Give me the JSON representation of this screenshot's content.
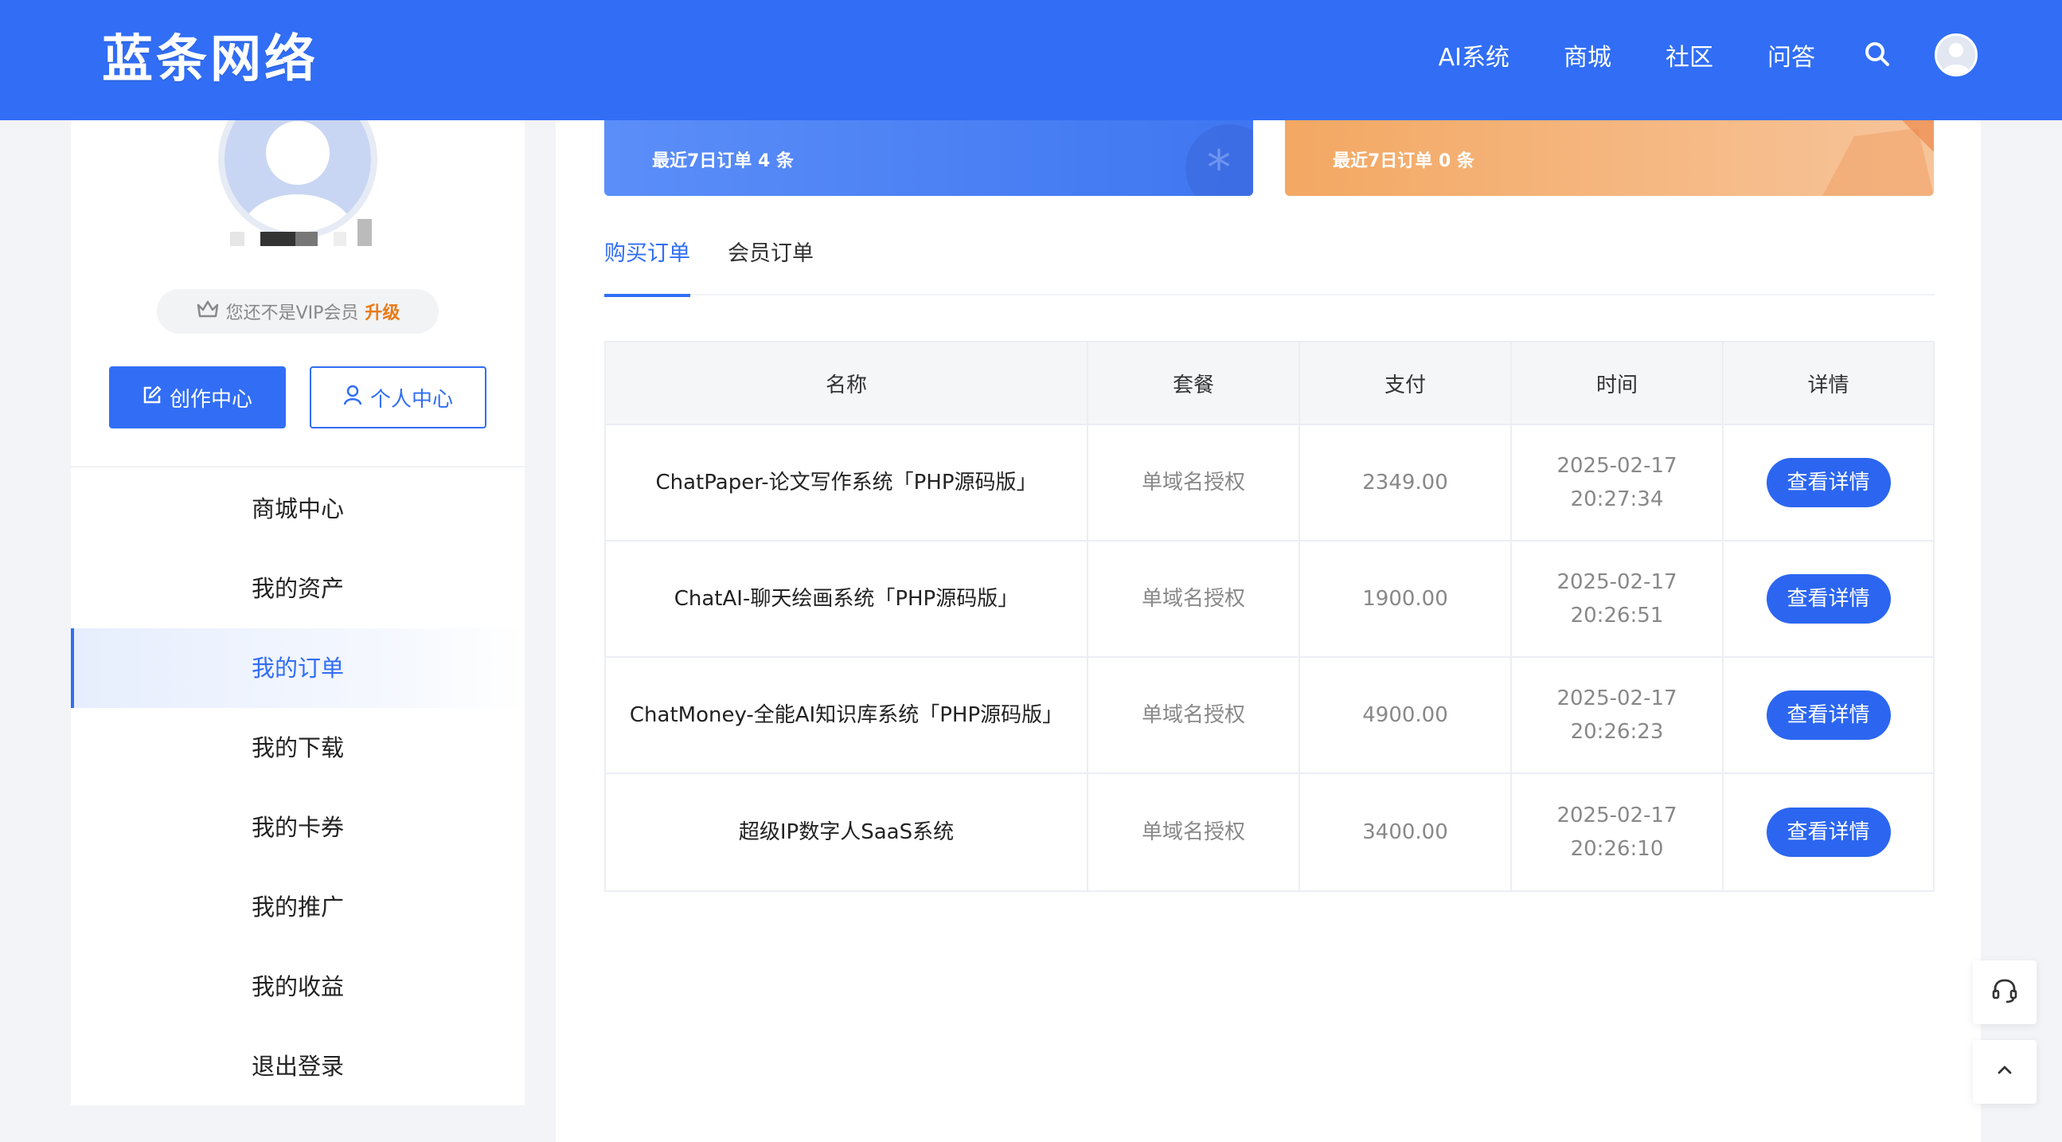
{
  "header": {
    "logo_text": "蓝条网络",
    "nav": [
      "AI系统",
      "商城",
      "社区",
      "问答"
    ]
  },
  "sidebar": {
    "vip_text": "您还不是VIP会员",
    "vip_upgrade": "升级",
    "create_button": "创作中心",
    "personal_button": "个人中心",
    "menu": [
      {
        "label": "商城中心",
        "active": false
      },
      {
        "label": "我的资产",
        "active": false
      },
      {
        "label": "我的订单",
        "active": true
      },
      {
        "label": "我的下载",
        "active": false
      },
      {
        "label": "我的卡券",
        "active": false
      },
      {
        "label": "我的推广",
        "active": false
      },
      {
        "label": "我的收益",
        "active": false
      },
      {
        "label": "退出登录",
        "active": false
      }
    ]
  },
  "stats": {
    "card1": "最近7日订单 4 条",
    "card2": "最近7日订单 0 条"
  },
  "tabs": {
    "active": "购买订单",
    "inactive": "会员订单"
  },
  "table": {
    "headers": [
      "名称",
      "套餐",
      "支付",
      "时间",
      "详情"
    ],
    "rows": [
      {
        "name": "ChatPaper-论文写作系统「PHP源码版」",
        "plan": "单域名授权",
        "pay": "2349.00",
        "date": "2025-02-17",
        "time": "20:27:34",
        "action": "查看详情"
      },
      {
        "name": "ChatAI-聊天绘画系统「PHP源码版」",
        "plan": "单域名授权",
        "pay": "1900.00",
        "date": "2025-02-17",
        "time": "20:26:51",
        "action": "查看详情"
      },
      {
        "name": "ChatMoney-全能AI知识库系统「PHP源码版」",
        "plan": "单域名授权",
        "pay": "4900.00",
        "date": "2025-02-17",
        "time": "20:26:23",
        "action": "查看详情"
      },
      {
        "name": "超级IP数字人SaaS系统",
        "plan": "单域名授权",
        "pay": "3400.00",
        "date": "2025-02-17",
        "time": "20:26:10",
        "action": "查看详情"
      }
    ]
  },
  "colors": {
    "primary": "#316ef5",
    "upgrade": "#ea7a18"
  },
  "icons": [
    "search-icon",
    "user-avatar-icon",
    "crown-icon",
    "edit-icon",
    "user-icon",
    "headset-icon",
    "chevron-up-icon"
  ]
}
